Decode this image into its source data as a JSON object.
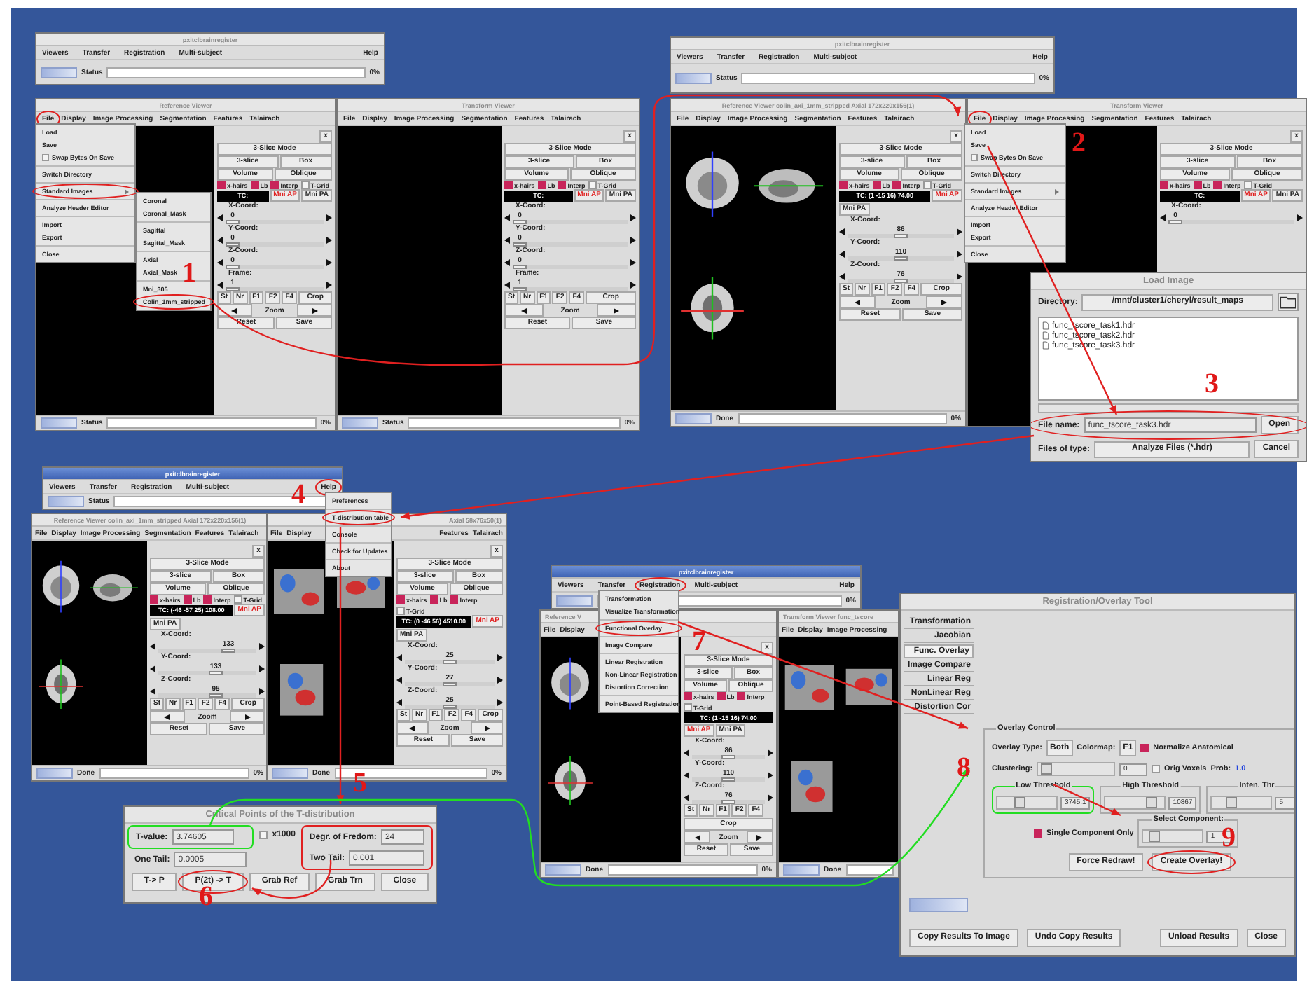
{
  "main_windows": [
    {
      "title": "pxitclbrainregister",
      "active": false,
      "menus": [
        {
          "label": "Viewers",
          "circled": false
        },
        {
          "label": "Transfer",
          "circled": false
        },
        {
          "label": "Registration",
          "circled": false
        },
        {
          "label": "Multi-subject",
          "circled": false
        },
        {
          "label": "Help",
          "circled": false
        }
      ],
      "status_label": "Status",
      "percent": "0%"
    },
    {
      "title": "pxitclbrainregister",
      "active": false,
      "menus": [
        {
          "label": "Viewers",
          "circled": false
        },
        {
          "label": "Transfer",
          "circled": false
        },
        {
          "label": "Registration",
          "circled": false
        },
        {
          "label": "Multi-subject",
          "circled": false
        },
        {
          "label": "Help",
          "circled": false
        }
      ],
      "status_label": "Status",
      "percent": "0%"
    },
    {
      "title": "pxitclbrainregister",
      "active": true,
      "menus": [
        {
          "label": "Viewers",
          "circled": false
        },
        {
          "label": "Transfer",
          "circled": false
        },
        {
          "label": "Registration",
          "circled": false
        },
        {
          "label": "Multi-subject",
          "circled": false
        },
        {
          "label": "Help",
          "circled": true
        }
      ],
      "status_label": "Status"
    },
    {
      "title": "pxitclbrainregister",
      "active": true,
      "menus": [
        {
          "label": "Viewers",
          "circled": false
        },
        {
          "label": "Transfer",
          "circled": false
        },
        {
          "label": "Registration",
          "circled": true
        },
        {
          "label": "Multi-subject",
          "circled": false
        },
        {
          "label": "Help",
          "circled": false
        }
      ],
      "percent": "0%"
    }
  ],
  "viewers": [
    {
      "title": "Reference Viewer",
      "menus": [
        {
          "label": "File",
          "circled": true
        },
        {
          "label": "Display",
          "circled": false
        },
        {
          "label": "Image Processing",
          "circled": false
        },
        {
          "label": "Segmentation",
          "circled": false
        },
        {
          "label": "Features",
          "circled": false
        },
        {
          "label": "Talairach",
          "circled": false
        }
      ],
      "kind": "empty",
      "controls": {
        "close": "x",
        "mode": "3-Slice Mode",
        "view": [
          "3-slice",
          "Box"
        ],
        "render": [
          "Volume",
          "Oblique"
        ],
        "checks": [
          {
            "label": "x-hairs",
            "checked": true
          },
          {
            "label": "Lb",
            "checked": true
          },
          {
            "label": "Interp",
            "checked": true
          },
          {
            "label": "T-Grid",
            "checked": false
          }
        ],
        "tc": "TC:",
        "mni": [
          "Mni AP",
          "Mni PA"
        ],
        "coords": [
          {
            "label": "X-Coord:",
            "value": "0",
            "level": 0
          },
          {
            "label": "Y-Coord:",
            "value": "0",
            "level": 0
          },
          {
            "label": "Z-Coord:",
            "value": "0",
            "level": 0
          },
          {
            "label": "Frame:",
            "value": "1",
            "level": 0
          }
        ],
        "tools": [
          "St",
          "Nr",
          "F1",
          "F2",
          "F4"
        ],
        "crop": "Crop",
        "zoom": "Zoom",
        "actions": [
          "Reset",
          "Save"
        ]
      },
      "status": {
        "label": "Status",
        "percent": "0%"
      }
    },
    {
      "title": "Transform Viewer",
      "menus": [
        {
          "label": "File",
          "circled": false
        },
        {
          "label": "Display",
          "circled": false
        },
        {
          "label": "Image Processing",
          "circled": false
        },
        {
          "label": "Segmentation",
          "circled": false
        },
        {
          "label": "Features",
          "circled": false
        },
        {
          "label": "Talairach",
          "circled": false
        }
      ],
      "kind": "empty",
      "controls": {
        "close": "x",
        "mode": "3-Slice Mode",
        "view": [
          "3-slice",
          "Box"
        ],
        "render": [
          "Volume",
          "Oblique"
        ],
        "checks": [
          {
            "label": "x-hairs",
            "checked": true
          },
          {
            "label": "Lb",
            "checked": true
          },
          {
            "label": "Interp",
            "checked": true
          },
          {
            "label": "T-Grid",
            "checked": false
          }
        ],
        "tc": "TC:",
        "mni": [
          "Mni AP",
          "Mni PA"
        ],
        "coords": [
          {
            "label": "X-Coord:",
            "value": "0",
            "level": 0
          },
          {
            "label": "Y-Coord:",
            "value": "0",
            "level": 0
          },
          {
            "label": "Z-Coord:",
            "value": "0",
            "level": 0
          },
          {
            "label": "Frame:",
            "value": "1",
            "level": 0
          }
        ],
        "tools": [
          "St",
          "Nr",
          "F1",
          "F2",
          "F4"
        ],
        "crop": "Crop",
        "zoom": "Zoom",
        "actions": [
          "Reset",
          "Save"
        ]
      },
      "status": {
        "label": "Status",
        "percent": "0%"
      }
    },
    {
      "title": "Reference Viewer colin_axi_1mm_stripped Axial 172x220x156(1)",
      "menus": [
        {
          "label": "File",
          "circled": false
        },
        {
          "label": "Display",
          "circled": false
        },
        {
          "label": "Image Processing",
          "circled": false
        },
        {
          "label": "Segmentation",
          "circled": false
        },
        {
          "label": "Features",
          "circled": false
        },
        {
          "label": "Talairach",
          "circled": false
        }
      ],
      "kind": "brain",
      "controls": {
        "close": "x",
        "mode": "3-Slice Mode",
        "view": [
          "3-slice",
          "Box"
        ],
        "render": [
          "Volume",
          "Oblique"
        ],
        "checks": [
          {
            "label": "x-hairs",
            "checked": true
          },
          {
            "label": "Lb",
            "checked": true
          },
          {
            "label": "Interp",
            "checked": true
          },
          {
            "label": "T-Grid",
            "checked": false
          }
        ],
        "tc": "TC: (1 -15 16) 74.00",
        "mni": [
          "Mni AP",
          "Mni PA"
        ],
        "coords": [
          {
            "label": "X-Coord:",
            "value": "86",
            "level": 0.5
          },
          {
            "label": "Y-Coord:",
            "value": "110",
            "level": 0.5
          },
          {
            "label": "Z-Coord:",
            "value": "76",
            "level": 0.5
          }
        ],
        "tools": [
          "St",
          "Nr",
          "F1",
          "F2",
          "F4"
        ],
        "crop": "Crop",
        "zoom": "Zoom",
        "actions": [
          "Reset",
          "Save"
        ]
      },
      "status": {
        "label": "Done",
        "percent": "0%"
      }
    },
    {
      "title": "Transform Viewer",
      "menus": [
        {
          "label": "File",
          "circled": true
        },
        {
          "label": "Display",
          "circled": false
        },
        {
          "label": "Image Processing",
          "circled": false
        },
        {
          "label": "Segmentation",
          "circled": false
        },
        {
          "label": "Features",
          "circled": false
        },
        {
          "label": "Talairach",
          "circled": false
        }
      ],
      "kind": "empty",
      "controls": {
        "close": "x",
        "mode": "3-Slice Mode",
        "view": [
          "3-slice",
          "Box"
        ],
        "render": [
          "Volume",
          "Oblique"
        ],
        "checks": [
          {
            "label": "x-hairs",
            "checked": true
          },
          {
            "label": "Lb",
            "checked": true
          },
          {
            "label": "Interp",
            "checked": true
          },
          {
            "label": "T-Grid",
            "checked": false
          }
        ],
        "tc": "TC:",
        "mni": [
          "Mni AP",
          "Mni PA"
        ],
        "coords": [
          {
            "label": "X-Coord:",
            "value": "0",
            "level": 0
          }
        ]
      }
    },
    {
      "title": "Reference Viewer colin_axi_1mm_stripped Axial 172x220x156(1)",
      "menus": [
        {
          "label": "File",
          "circled": false
        },
        {
          "label": "Display",
          "circled": false
        },
        {
          "label": "Image Processing",
          "circled": false
        },
        {
          "label": "Segmentation",
          "circled": false
        },
        {
          "label": "Features",
          "circled": false
        },
        {
          "label": "Talairach",
          "circled": false
        }
      ],
      "kind": "brain",
      "controls": {
        "close": "x",
        "mode": "3-Slice Mode",
        "view": [
          "3-slice",
          "Box"
        ],
        "render": [
          "Volume",
          "Oblique"
        ],
        "checks": [
          {
            "label": "x-hairs",
            "checked": true
          },
          {
            "label": "Lb",
            "checked": true
          },
          {
            "label": "Interp",
            "checked": true
          },
          {
            "label": "T-Grid",
            "checked": false
          }
        ],
        "tc": "TC: (-46 -57 25) 108.00",
        "mni": [
          "Mni AP",
          "Mni PA"
        ],
        "coords": [
          {
            "label": "X-Coord:",
            "value": "133",
            "level": 0.75
          },
          {
            "label": "Y-Coord:",
            "value": "133",
            "level": 0.6
          },
          {
            "label": "Z-Coord:",
            "value": "95",
            "level": 0.6
          }
        ],
        "tools": [
          "St",
          "Nr",
          "F1",
          "F2",
          "F4"
        ],
        "crop": "Crop",
        "zoom": "Zoom",
        "actions": [
          "Reset",
          "Save"
        ]
      },
      "status": {
        "label": "Done",
        "percent": "0%"
      }
    },
    {
      "title": "Axial 58x76x50(1)",
      "menus": [
        {
          "label": "File",
          "circled": false
        },
        {
          "label": "Display",
          "circled": false
        },
        {
          "label": "Features",
          "circled": false
        },
        {
          "label": "Talairach",
          "circled": false
        }
      ],
      "kind": "overlay",
      "controls": {
        "close": "x",
        "mode": "3-Slice Mode",
        "view": [
          "3-slice",
          "Box"
        ],
        "render": [
          "Volume",
          "Oblique"
        ],
        "checks": [
          {
            "label": "x-hairs",
            "checked": true
          },
          {
            "label": "Lb",
            "checked": true
          },
          {
            "label": "Interp",
            "checked": true
          },
          {
            "label": "T-Grid",
            "checked": false
          }
        ],
        "tc": "TC: (0 -46 56) 4510.00",
        "mni": [
          "Mni AP",
          "Mni PA"
        ],
        "coords": [
          {
            "label": "X-Coord:",
            "value": "25",
            "level": 0.5
          },
          {
            "label": "Y-Coord:",
            "value": "27",
            "level": 0.5
          },
          {
            "label": "Z-Coord:",
            "value": "25",
            "level": 0.5
          }
        ],
        "tools": [
          "St",
          "Nr",
          "F1",
          "F2",
          "F4"
        ],
        "crop": "Crop",
        "zoom": "Zoom",
        "actions": [
          "Reset",
          "Save"
        ]
      },
      "status": {
        "label": "Done",
        "percent": "0%"
      }
    },
    {
      "title": "Reference V",
      "menus": [
        {
          "label": "File",
          "circled": false
        },
        {
          "label": "Display",
          "circled": false
        }
      ],
      "kind": "brain",
      "controls": {
        "close": "x",
        "mode": "3-Slice Mode",
        "view": [
          "3-slice",
          "Box"
        ],
        "render": [
          "Volume",
          "Oblique"
        ],
        "checks": [
          {
            "label": "x-hairs",
            "checked": true
          },
          {
            "label": "Lb",
            "checked": true
          },
          {
            "label": "Interp",
            "checked": true
          },
          {
            "label": "T-Grid",
            "checked": false
          }
        ],
        "tc": "TC: (1 -15 16) 74.00",
        "mni": [
          "Mni AP",
          "Mni PA"
        ],
        "coords": [
          {
            "label": "X-Coord:",
            "value": "86",
            "level": 0.5
          },
          {
            "label": "Y-Coord:",
            "value": "110",
            "level": 0.5
          },
          {
            "label": "Z-Coord:",
            "value": "76",
            "level": 0.5
          }
        ],
        "tools": [
          "St",
          "Nr",
          "F1",
          "F2",
          "F4"
        ],
        "crop": "Crop",
        "zoom": "Zoom",
        "actions": [
          "Reset",
          "Save"
        ]
      },
      "status": {
        "label": "Done",
        "percent": "0%"
      }
    },
    {
      "title": "Transform Viewer func_tscore",
      "menus": [
        {
          "label": "File",
          "circled": false
        },
        {
          "label": "Display",
          "circled": false
        },
        {
          "label": "Image Processing",
          "circled": false
        }
      ],
      "kind": "overlay",
      "status": {
        "label": "Done"
      }
    }
  ],
  "popup_menus": [
    {
      "groups": [
        [
          {
            "label": "Load",
            "kind": "plain"
          },
          {
            "label": "Save",
            "kind": "plain"
          },
          {
            "label": "Swap Bytes On Save",
            "kind": "check",
            "checked": false
          }
        ],
        [
          {
            "label": "Switch Directory",
            "kind": "plain"
          }
        ],
        [
          {
            "label": "Standard Images",
            "kind": "submenu",
            "circled": true
          }
        ],
        [
          {
            "label": "Analyze Header Editor",
            "kind": "plain"
          }
        ],
        [
          {
            "label": "Import",
            "kind": "plain"
          },
          {
            "label": "Export",
            "kind": "plain"
          }
        ],
        [
          {
            "label": "Close",
            "kind": "plain"
          }
        ]
      ]
    },
    {
      "groups": [
        [
          {
            "label": "Coronal",
            "kind": "plain"
          },
          {
            "label": "Coronal_Mask",
            "kind": "plain"
          }
        ],
        [
          {
            "label": "Sagittal",
            "kind": "plain"
          },
          {
            "label": "Sagittal_Mask",
            "kind": "plain"
          }
        ],
        [
          {
            "label": "Axial",
            "kind": "plain"
          },
          {
            "label": "Axial_Mask",
            "kind": "plain"
          }
        ],
        [
          {
            "label": "Mni_305",
            "kind": "plain"
          },
          {
            "label": "Colin_1mm_stripped",
            "kind": "plain",
            "circled": true
          }
        ]
      ]
    },
    {
      "groups": [
        [
          {
            "label": "Load",
            "kind": "plain"
          },
          {
            "label": "Save",
            "kind": "plain"
          },
          {
            "label": "Swap Bytes On Save",
            "kind": "check",
            "checked": false
          }
        ],
        [
          {
            "label": "Switch Directory",
            "kind": "plain"
          }
        ],
        [
          {
            "label": "Standard Images",
            "kind": "submenu"
          }
        ],
        [
          {
            "label": "Analyze Header Editor",
            "kind": "plain"
          }
        ],
        [
          {
            "label": "Import",
            "kind": "plain"
          },
          {
            "label": "Export",
            "kind": "plain"
          }
        ],
        [
          {
            "label": "Close",
            "kind": "plain"
          }
        ]
      ]
    },
    {
      "groups": [
        [
          {
            "label": "Preferences",
            "kind": "plain"
          }
        ],
        [
          {
            "label": "T-distribution table",
            "kind": "plain",
            "circled": true
          }
        ],
        [
          {
            "label": "Console",
            "kind": "plain"
          }
        ],
        [
          {
            "label": "Check for Updates",
            "kind": "plain"
          }
        ],
        [
          {
            "label": "About",
            "kind": "plain"
          }
        ]
      ]
    },
    {
      "groups": [
        [
          {
            "label": "Transformation",
            "kind": "plain"
          },
          {
            "label": "Visualize Transformation",
            "kind": "plain"
          }
        ],
        [
          {
            "label": "Functional Overlay",
            "kind": "plain",
            "circled": true
          }
        ],
        [
          {
            "label": "Image Compare",
            "kind": "plain"
          }
        ],
        [
          {
            "label": "Linear Registration",
            "kind": "plain"
          },
          {
            "label": "Non-Linear Registration",
            "kind": "plain"
          },
          {
            "label": "Distortion Correction",
            "kind": "plain"
          }
        ],
        [
          {
            "label": "Point-Based Registration",
            "kind": "plain"
          }
        ]
      ]
    }
  ],
  "load_image_dialog": {
    "title": "Load Image",
    "directory_label": "Directory:",
    "directory": "/mnt/cluster1/cheryl/result_maps",
    "files": [
      "func_tscore_task1.hdr",
      "func_tscore_task2.hdr",
      "func_tscore_task3.hdr"
    ],
    "file_name_label": "File name:",
    "file_name": "func_tscore_task3.hdr",
    "file_name_circled": true,
    "open": "Open",
    "type_label": "Files of type:",
    "type": "Analyze Files (*.hdr)",
    "cancel": "Cancel"
  },
  "t_distribution_dialog": {
    "title": "Critical Points of the T-distribution",
    "t_label": "T-value:",
    "t_value": "3.74605",
    "t_value_framed": true,
    "tails_framed": true,
    "x1000": {
      "label": "x1000",
      "checked": false
    },
    "dof_label": "Degr. of Fredom:",
    "dof": "24",
    "one_tail_label": "One Tail:",
    "one_tail": "0.0005",
    "two_tail_label": "Two Tail:",
    "two_tail": "0.001",
    "buttons": [
      {
        "label": "T-> P",
        "circled": false
      },
      {
        "label": "P(2t) -> T",
        "circled": true
      },
      {
        "label": "Grab Ref",
        "circled": false
      },
      {
        "label": "Grab Trn",
        "circled": false
      },
      {
        "label": "Close",
        "circled": false
      }
    ]
  },
  "overlay_tool": {
    "title": "Registration/Overlay Tool",
    "tabs": [
      {
        "label": "Transformation",
        "selected": false
      },
      {
        "label": "Jacobian",
        "selected": false
      },
      {
        "label": "Func. Overlay",
        "selected": true
      },
      {
        "label": "Image Compare",
        "selected": false
      },
      {
        "label": "Linear Reg",
        "selected": false
      },
      {
        "label": "NonLinear Reg",
        "selected": false
      },
      {
        "label": "Distortion Cor",
        "selected": false
      }
    ],
    "group_title": "Overlay Control",
    "overlay_type_label": "Overlay Type:",
    "overlay_type": "Both",
    "colormap_label": "Colormap:",
    "colormap": "F1",
    "normalize": {
      "label": "Normalize Anatomical",
      "checked": true
    },
    "clustering_label": "Clustering:",
    "clustering": {
      "level": 0.05,
      "value": "0"
    },
    "orig_voxels": {
      "label": "Orig Voxels",
      "checked": false
    },
    "prob_label": "Prob:",
    "prob": "1.0",
    "thresholds": [
      {
        "label": "Low Threshold",
        "level": 0.35,
        "value": "3745.1",
        "framed": true
      },
      {
        "label": "High Threshold",
        "level": 0.85,
        "value": "10867",
        "framed": false
      },
      {
        "label": "Inten. Thr",
        "level": 0.3,
        "value": "5",
        "framed": false
      }
    ],
    "single_component": {
      "label": "Single Component Only",
      "checked": true
    },
    "select_component": {
      "label": "Select Component:",
      "level": 0.1,
      "value": "1"
    },
    "buttons": [
      {
        "label": "Force Redraw!",
        "circled": false
      },
      {
        "label": "Create Overlay!",
        "circled": true
      }
    ],
    "footer_buttons": [
      "Copy Results To Image",
      "Undo Copy Results",
      "Unload Results",
      "Close"
    ]
  },
  "step_numbers": [
    "1",
    "2",
    "3",
    "4",
    "5",
    "6",
    "7",
    "8",
    "9"
  ]
}
